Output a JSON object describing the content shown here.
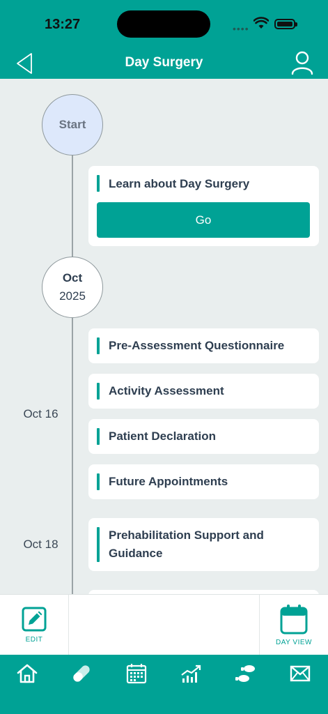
{
  "status": {
    "time": "13:27",
    "signal": "••••"
  },
  "header": {
    "title": "Day Surgery",
    "back_icon": "back-chevron-icon",
    "profile_icon": "user-icon"
  },
  "timeline": {
    "start_label": "Start",
    "intro": {
      "label": "Learn about Day Surgery",
      "button": "Go"
    },
    "month": {
      "month": "Oct",
      "year": "2025"
    },
    "dates": [
      "Oct 16",
      "Oct 18"
    ],
    "items": [
      "Pre-Assessment Questionnaire",
      "Activity Assessment",
      "Patient Declaration",
      "Future Appointments",
      "Prehabilitation Support and Guidance"
    ]
  },
  "toolbar": {
    "edit_label": "EDIT",
    "day_view_label": "DAY VIEW"
  },
  "tabs": [
    "home-icon",
    "pill-icon",
    "calendar-icon",
    "chart-icon",
    "footsteps-icon",
    "mail-icon"
  ],
  "colors": {
    "accent": "#00a295",
    "background": "#e9eeee",
    "start_circle": "#dde8fb"
  }
}
